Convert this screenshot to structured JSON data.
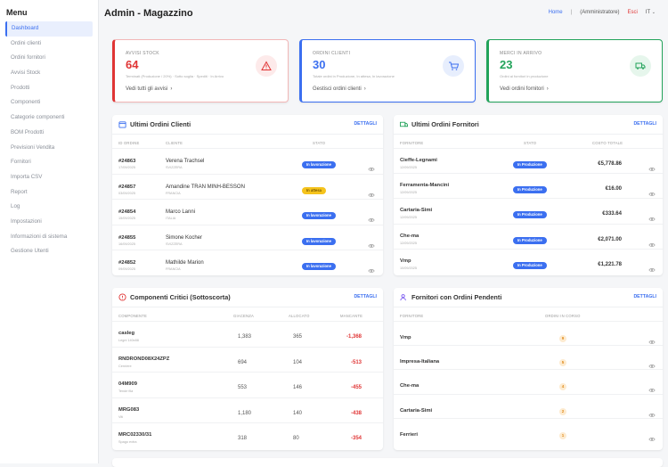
{
  "sidebar": {
    "title": "Menu",
    "items": [
      "Dashboard",
      "Ordini clienti",
      "Ordini fornitori",
      "Avvisi Stock",
      "Prodotti",
      "Componenti",
      "Categorie componenti",
      "BOM Prodotti",
      "Previsioni Vendita",
      "Fornitori",
      "Importa CSV",
      "Report",
      "Log",
      "Impostazioni",
      "Informazioni di sistema",
      "Gestione Utenti"
    ]
  },
  "header": {
    "title": "Admin - Magazzino",
    "home": "Home",
    "sep": "|",
    "user": "(Amministratore)",
    "exit": "Esci",
    "lang": "IT"
  },
  "stats": [
    {
      "label": "AVVISI STOCK",
      "value": "64",
      "desc": "Terminati (Produzione / 20%) · Sotto soglia · Spediti · In Arrivo",
      "link": "Vedi tutti gli avvisi",
      "color": "#e03535",
      "bg": "#fdeaea",
      "border": "#f2b7b7",
      "icon": "warning-icon"
    },
    {
      "label": "ORDINI CLIENTI",
      "value": "30",
      "desc": "Totale ordini in Produzione, In attesa, In lavorazione",
      "link": "Gestisci ordini clienti",
      "color": "#3b6ff0",
      "bg": "#e7eefd",
      "border": "#3b6ff0",
      "icon": "cart-icon"
    },
    {
      "label": "MERCI IN ARRIVO",
      "value": "23",
      "desc": "Ordini ai fornitori in produzione",
      "link": "Vedi ordini fornitori",
      "color": "#22a35a",
      "bg": "#e6f6ec",
      "border": "#22a35a",
      "icon": "truck-icon"
    }
  ],
  "clientOrders": {
    "title": "Ultimi Ordini Clienti",
    "details": "DETTAGLI",
    "cols": [
      "ID ORDINE",
      "CLIENTE",
      "STATO"
    ],
    "rows": [
      {
        "id": "#24863",
        "date": "17/09/2025",
        "client": "Verena Trachsel",
        "country": "SVIZZERA",
        "status": "In lavorazione",
        "badge": "b"
      },
      {
        "id": "#24857",
        "date": "03/09/2025",
        "client": "Amandine TRAN MINH-BESSON",
        "country": "FRANCIA",
        "status": "In attesa",
        "badge": "y"
      },
      {
        "id": "#24854",
        "date": "15/09/2025",
        "client": "Marco Lanni",
        "country": "ITALIA",
        "status": "In lavorazione",
        "badge": "b"
      },
      {
        "id": "#24855",
        "date": "16/09/2025",
        "client": "Simone Kocher",
        "country": "SVIZZERA",
        "status": "In lavorazione",
        "badge": "b"
      },
      {
        "id": "#24852",
        "date": "09/09/2025",
        "client": "Mathilde Marion",
        "country": "FRANCIA",
        "status": "In lavorazione",
        "badge": "b"
      }
    ]
  },
  "supplierOrders": {
    "title": "Ultimi Ordini Fornitori",
    "details": "DETTAGLI",
    "cols": [
      "FORNITORE",
      "STATO",
      "COSTO TOTALE"
    ],
    "rows": [
      {
        "name": "Cieffe-Legnami",
        "date": "12/09/2025",
        "status": "In Produzione",
        "total": "€5,778.86"
      },
      {
        "name": "Ferramenta-Mancini",
        "date": "12/09/2025",
        "status": "In Produzione",
        "total": "€16.00"
      },
      {
        "name": "Cartaria-Simi",
        "date": "12/09/2025",
        "status": "In Produzione",
        "total": "€333.64"
      },
      {
        "name": "Che-ma",
        "date": "12/09/2025",
        "status": "In Produzione",
        "total": "€2,071.00"
      },
      {
        "name": "Vmp",
        "date": "10/09/2025",
        "status": "In Produzione",
        "total": "€1,221.78"
      }
    ]
  },
  "critical": {
    "title": "Componenti Critici (Sottoscorta)",
    "details": "DETTAGLI",
    "cols": [
      "COMPONENTE",
      "GIACENZA",
      "ALLOCATO",
      "MANCANTE"
    ],
    "rows": [
      {
        "code": "casleg",
        "desc": "Legni 140x88",
        "stock": "1,383",
        "alloc": "365",
        "missing": "-1,368"
      },
      {
        "code": "RNDROND08X24ZPZ",
        "desc": "Cerniere",
        "stock": "694",
        "alloc": "104",
        "missing": "-513"
      },
      {
        "code": "04M909",
        "desc": "Tende fila",
        "stock": "553",
        "alloc": "146",
        "missing": "-455"
      },
      {
        "code": "MRG083",
        "desc": "Viti",
        "stock": "1,180",
        "alloc": "140",
        "missing": "-438"
      },
      {
        "code": "MRC02330/31",
        "desc": "Spago extra",
        "stock": "318",
        "alloc": "80",
        "missing": "-354"
      }
    ]
  },
  "pending": {
    "title": "Fornitori con Ordini Pendenti",
    "details": "DETTAGLI",
    "cols": [
      "FORNITORE",
      "ORDINI IN CORSO"
    ],
    "rows": [
      {
        "name": "Vmp",
        "count": "9"
      },
      {
        "name": "Impresa-Italiana",
        "count": "5"
      },
      {
        "name": "Che-ma",
        "count": "4"
      },
      {
        "name": "Cartaria-Simi",
        "count": "2"
      },
      {
        "name": "Ferrieri",
        "count": "1"
      }
    ]
  }
}
